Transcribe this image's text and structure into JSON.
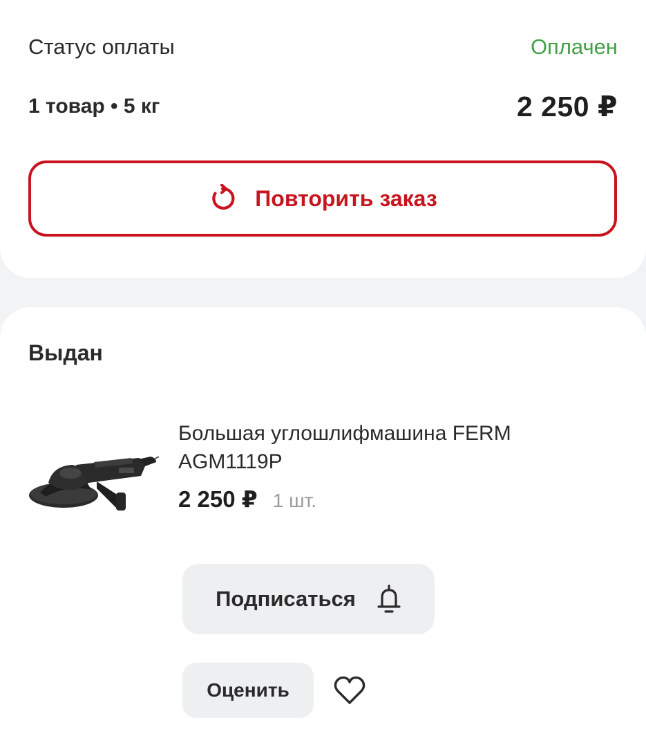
{
  "payment": {
    "label": "Статус оплаты",
    "status": "Оплачен",
    "status_color": "#43a047"
  },
  "summary": {
    "items_text": "1 товар • 5 кг",
    "total": "2 250 ₽"
  },
  "repeat_order": {
    "label": "Повторить заказ",
    "icon": "repeat-icon",
    "color": "#c8141e"
  },
  "shipment": {
    "status": "Выдан",
    "product": {
      "name": "Большая углошлифмашина FERM AGM1119P",
      "price": "2 250 ₽",
      "quantity": "1 шт.",
      "image": "angle-grinder-image"
    },
    "subscribe": {
      "label": "Подписаться",
      "icon": "bell-icon"
    },
    "rate": {
      "label": "Оценить"
    },
    "favorite": {
      "icon": "heart-icon"
    }
  }
}
